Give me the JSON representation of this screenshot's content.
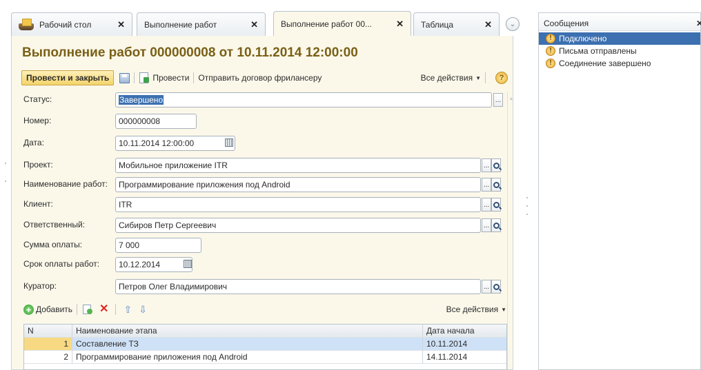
{
  "tabs": [
    {
      "label": "Рабочий стол",
      "close": "✕"
    },
    {
      "label": "Выполнение работ",
      "close": "✕"
    },
    {
      "label": "Выполнение работ 00...",
      "close": "✕"
    },
    {
      "label": "Таблица",
      "close": "✕"
    }
  ],
  "tabs_more_glyph": "⌄",
  "document": {
    "title": "Выполнение работ 000000008 от 10.11.2014 12:00:00"
  },
  "toolbar": {
    "post_close_label": "Провести и закрыть",
    "post_label": "Провести",
    "send_contract_label": "Отправить договор фрилансеру",
    "all_actions_label": "Все действия",
    "dropdown_glyph": "▼",
    "help_glyph": "?"
  },
  "fields": {
    "status": {
      "label": "Статус:",
      "value": "Завершено"
    },
    "number": {
      "label": "Номер:",
      "value": "000000008"
    },
    "date": {
      "label": "Дата:",
      "value": "10.11.2014 12:00:00"
    },
    "project": {
      "label": "Проект:",
      "value": "Мобильное приложение ITR"
    },
    "work_name": {
      "label": "Наименование работ:",
      "value": "Программирование приложения под Android"
    },
    "client": {
      "label": "Клиент:",
      "value": "ITR"
    },
    "responsible": {
      "label": "Ответственный:",
      "value": "Сибиров Петр Сергеевич"
    },
    "payment_sum": {
      "label": "Сумма оплаты:",
      "value": "7 000"
    },
    "payment_due": {
      "label": "Срок оплаты работ:",
      "value": "10.12.2014"
    },
    "curator": {
      "label": "Куратор:",
      "value": "Петров Олег Владимирович"
    },
    "choose_glyph": "..."
  },
  "table_toolbar": {
    "add_label": "Добавить",
    "add_glyph": "+",
    "delete_glyph": "✕",
    "up_glyph": "⇧",
    "down_glyph": "⇩",
    "all_actions_label": "Все действия",
    "dropdown_glyph": "▼"
  },
  "table": {
    "columns": [
      "N",
      "Наименование этапа",
      "Дата начала"
    ],
    "rows": [
      {
        "n": "1",
        "name": "Составление ТЗ",
        "start": "10.11.2014"
      },
      {
        "n": "2",
        "name": "Программирование приложения под Android",
        "start": "14.11.2014"
      }
    ]
  },
  "messages": {
    "title": "Сообщения",
    "close": "✕",
    "icon_glyph": "!",
    "items": [
      {
        "text": "Подключено"
      },
      {
        "text": "Письма отправлены"
      },
      {
        "text": "Соединение завершено"
      }
    ]
  }
}
